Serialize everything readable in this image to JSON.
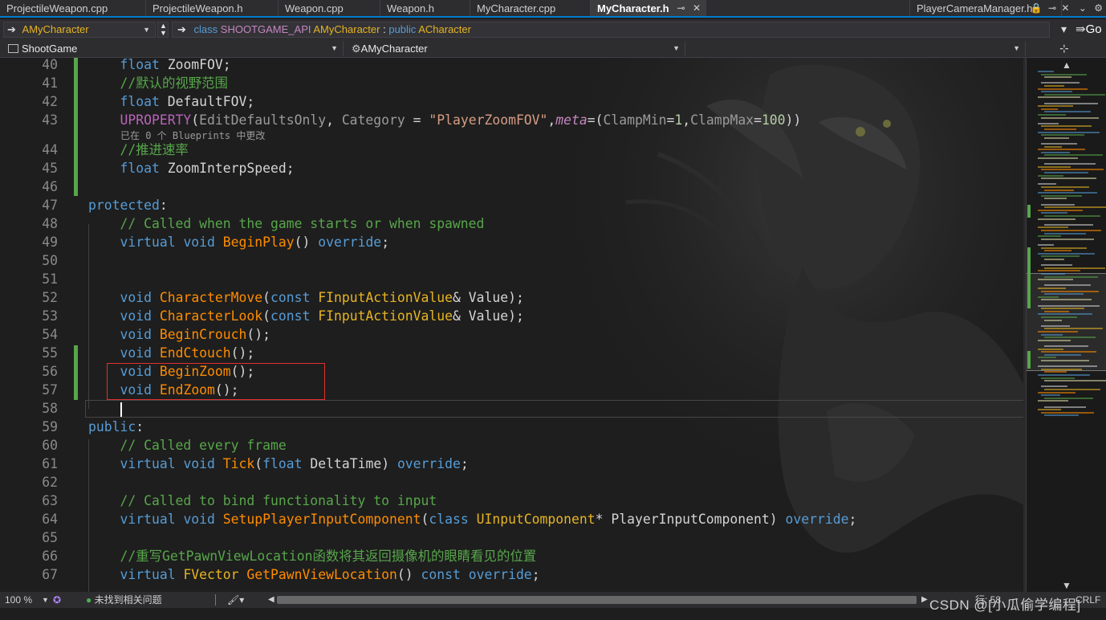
{
  "tabs": [
    {
      "label": "ProjectileWeapon.cpp",
      "active": false
    },
    {
      "label": "ProjectileWeapon.h",
      "active": false
    },
    {
      "label": "Weapon.cpp",
      "active": false
    },
    {
      "label": "Weapon.h",
      "active": false
    },
    {
      "label": "MyCharacter.cpp",
      "active": false
    },
    {
      "label": "MyCharacter.h",
      "active": true
    },
    {
      "label": "PlayerCameraManager.h",
      "active": false
    }
  ],
  "navbar": {
    "scope": "AMyCharacter",
    "sig_class": "class",
    "sig_macro": "SHOOTGAME_API",
    "sig_name": "AMyCharacter",
    "sig_colon": ":",
    "sig_public": "public",
    "sig_base": "ACharacter",
    "go_label": "Go"
  },
  "memberbar": {
    "project": "ShootGame",
    "member": "AMyCharacter"
  },
  "editor": {
    "hint_text": "已在 0 个 Blueprints 中更改",
    "lines": [
      {
        "num": "40",
        "text": "    float ZoomFOV;"
      },
      {
        "num": "41",
        "text": "    //默认的视野范围"
      },
      {
        "num": "42",
        "text": "    float DefaultFOV;"
      },
      {
        "num": "43",
        "text": "    UPROPERTY(EditDefaultsOnly, Category = \"PlayerZoomFOV\",meta=(ClampMin=1,ClampMax=100))"
      },
      {
        "num": "44",
        "text": "    //推进速率"
      },
      {
        "num": "45",
        "text": "    float ZoomInterpSpeed;"
      },
      {
        "num": "46",
        "text": ""
      },
      {
        "num": "47",
        "text": "protected:"
      },
      {
        "num": "48",
        "text": "    // Called when the game starts or when spawned"
      },
      {
        "num": "49",
        "text": "    virtual void BeginPlay() override;"
      },
      {
        "num": "50",
        "text": ""
      },
      {
        "num": "51",
        "text": ""
      },
      {
        "num": "52",
        "text": "    void CharacterMove(const FInputActionValue& Value);"
      },
      {
        "num": "53",
        "text": "    void CharacterLook(const FInputActionValue& Value);"
      },
      {
        "num": "54",
        "text": "    void BeginCrouch();"
      },
      {
        "num": "55",
        "text": "    void EndCtouch();"
      },
      {
        "num": "56",
        "text": "    void BeginZoom();"
      },
      {
        "num": "57",
        "text": "    void EndZoom();"
      },
      {
        "num": "58",
        "text": ""
      },
      {
        "num": "59",
        "text": "public:"
      },
      {
        "num": "60",
        "text": "    // Called every frame"
      },
      {
        "num": "61",
        "text": "    virtual void Tick(float DeltaTime) override;"
      },
      {
        "num": "62",
        "text": ""
      },
      {
        "num": "63",
        "text": "    // Called to bind functionality to input"
      },
      {
        "num": "64",
        "text": "    virtual void SetupPlayerInputComponent(class UInputComponent* PlayerInputComponent) override;"
      },
      {
        "num": "65",
        "text": ""
      },
      {
        "num": "66",
        "text": "    //重写GetPawnViewLocation函数将其返回摄像机的眼睛看见的位置"
      },
      {
        "num": "67",
        "text": "    virtual FVector GetPawnViewLocation() const override;"
      }
    ]
  },
  "statusbar": {
    "zoom": "100 %",
    "issues": "未找到相关问题",
    "position": "行: 58",
    "encoding": "CRLF"
  },
  "watermark": "CSDN @[小瓜偷学编程]",
  "colors": {
    "accent": "#007acc",
    "keyword": "#569cd6",
    "comment": "#57a64a",
    "function": "#ff8c00",
    "type": "#e6b422",
    "macro": "#b964b9",
    "string": "#d69d85",
    "highlight_box": "#e03030"
  }
}
